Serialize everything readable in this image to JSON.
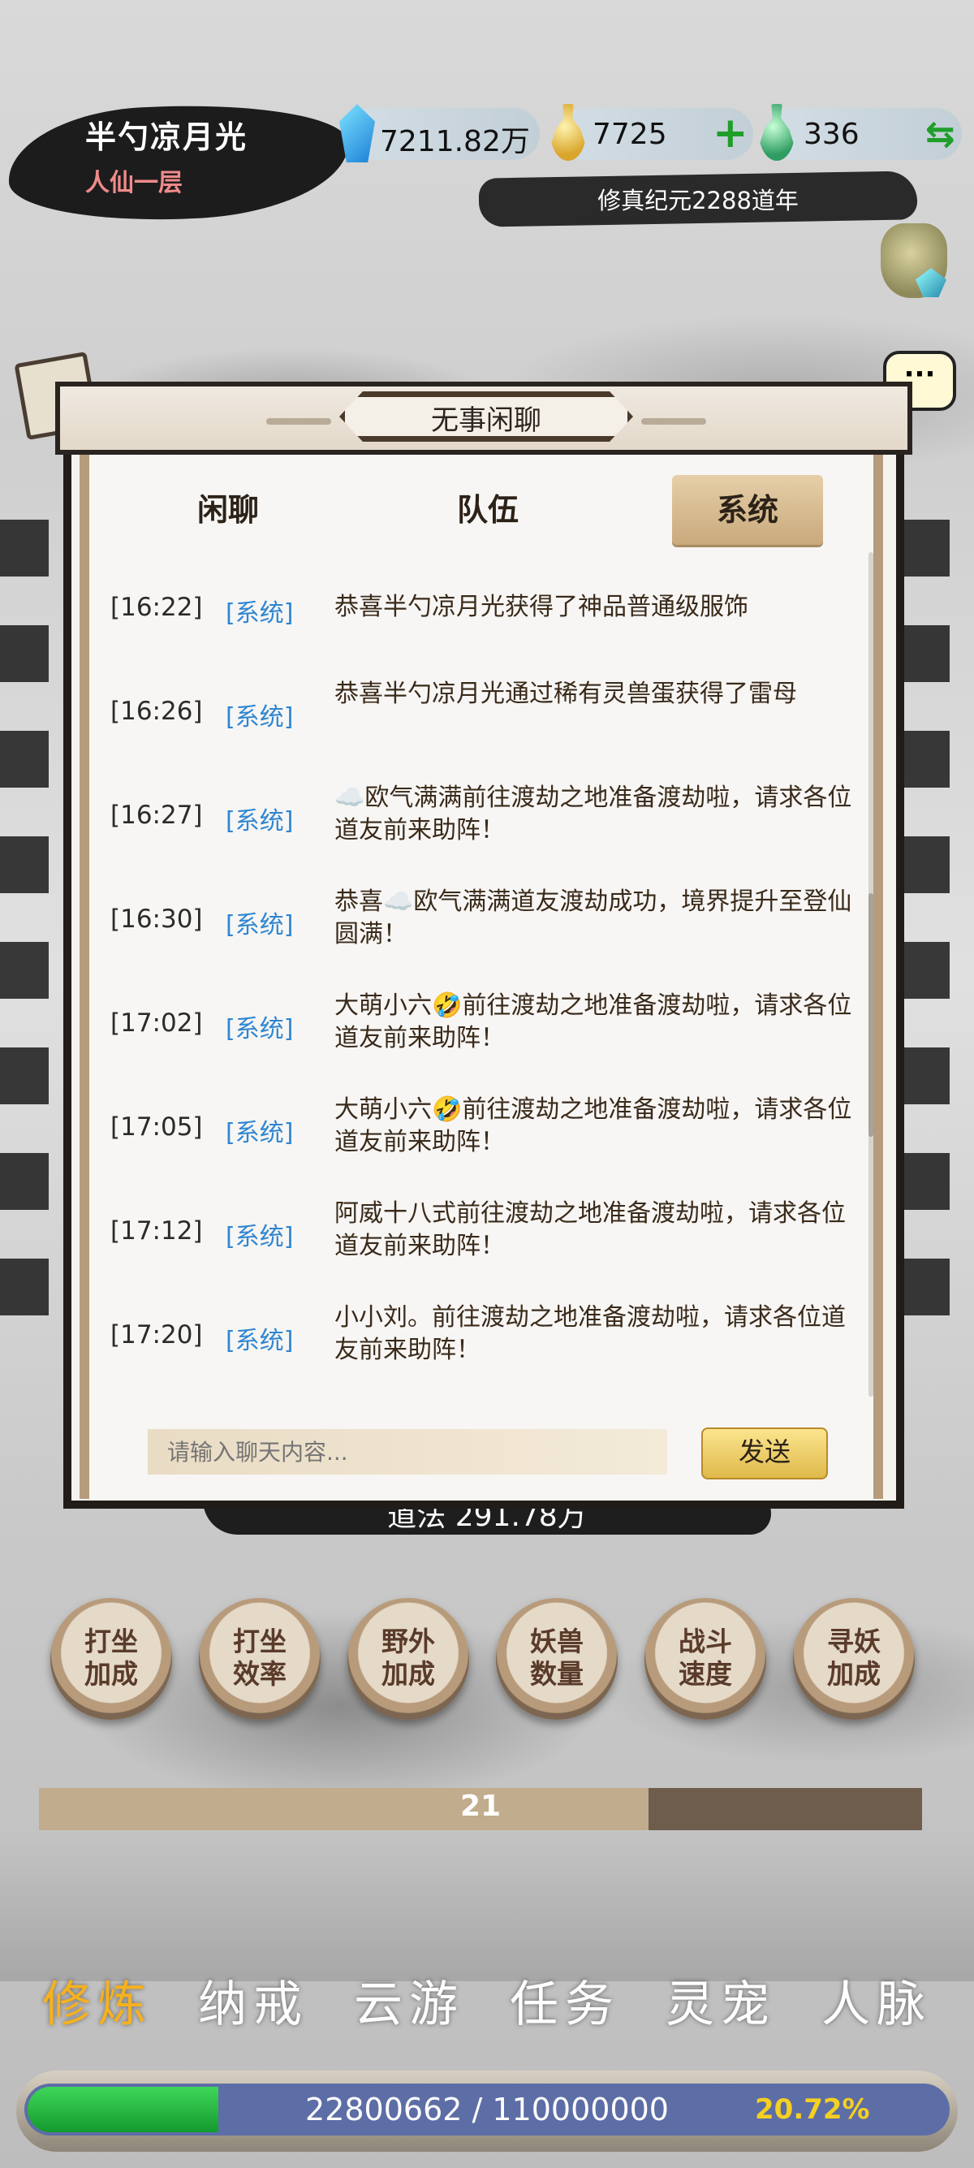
{
  "header": {
    "player_name": "半勺凉月光",
    "player_rank": "人仙一层",
    "spirit_stones": "7211.82万",
    "gold": "7725",
    "jade": "336",
    "era": "修真纪元2288道年"
  },
  "chat_panel": {
    "title": "无事闲聊",
    "tabs": [
      {
        "label": "闲聊",
        "active": false
      },
      {
        "label": "队伍",
        "active": false
      },
      {
        "label": "系统",
        "active": true
      }
    ],
    "messages": [
      {
        "time": "[16:22]",
        "tag": "[系统]",
        "text": "恭喜半勺凉月光获得了神品普通级服饰"
      },
      {
        "time": "[16:26]",
        "tag": "[系统]",
        "text": "恭喜半勺凉月光通过稀有灵兽蛋获得了雷母"
      },
      {
        "time": "[16:27]",
        "tag": "[系统]",
        "text": "☁️欧气满满前往渡劫之地准备渡劫啦，请求各位道友前来助阵！"
      },
      {
        "time": "[16:30]",
        "tag": "[系统]",
        "text": "恭喜☁️欧气满满道友渡劫成功，境界提升至登仙圆满！"
      },
      {
        "time": "[17:02]",
        "tag": "[系统]",
        "text": "大萌小六🤣前往渡劫之地准备渡劫啦，请求各位道友前来助阵！"
      },
      {
        "time": "[17:05]",
        "tag": "[系统]",
        "text": "大萌小六🤣前往渡劫之地准备渡劫啦，请求各位道友前来助阵！"
      },
      {
        "time": "[17:12]",
        "tag": "[系统]",
        "text": "阿威十八式前往渡劫之地准备渡劫啦，请求各位道友前来助阵！"
      },
      {
        "time": "[17:20]",
        "tag": "[系统]",
        "text": "小小刘。前往渡劫之地准备渡劫啦，请求各位道友前来助阵！"
      }
    ],
    "input_placeholder": "请输入聊天内容...",
    "send_label": "发送"
  },
  "dao_text": "道法 291.78万",
  "round_buttons": [
    {
      "line1": "打坐",
      "line2": "加成"
    },
    {
      "line1": "打坐",
      "line2": "效率"
    },
    {
      "line1": "野外",
      "line2": "加成"
    },
    {
      "line1": "妖兽",
      "line2": "数量"
    },
    {
      "line1": "战斗",
      "line2": "速度"
    },
    {
      "line1": "寻妖",
      "line2": "加成"
    }
  ],
  "level_bar": {
    "value": "21",
    "fill_fraction": 0.69
  },
  "nav": [
    {
      "label": "修炼",
      "active": true
    },
    {
      "label": "纳戒",
      "active": false
    },
    {
      "label": "云游",
      "active": false
    },
    {
      "label": "任务",
      "active": false
    },
    {
      "label": "灵宠",
      "active": false
    },
    {
      "label": "人脉",
      "active": false
    }
  ],
  "exp": {
    "text": "22800662 / 110000000",
    "percent": "20.72%",
    "fill_fraction": 0.2072
  },
  "colors": {
    "accent_gold": "#f5b120",
    "tag_blue": "#2f86d1",
    "exp_green": "#1fb33e"
  }
}
